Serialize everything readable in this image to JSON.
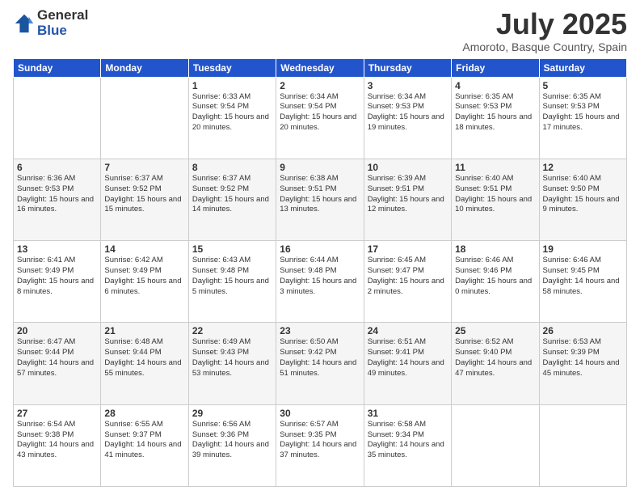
{
  "logo": {
    "general": "General",
    "blue": "Blue"
  },
  "title": {
    "month": "July 2025",
    "location": "Amoroto, Basque Country, Spain"
  },
  "headers": [
    "Sunday",
    "Monday",
    "Tuesday",
    "Wednesday",
    "Thursday",
    "Friday",
    "Saturday"
  ],
  "weeks": [
    [
      {
        "day": "",
        "sunrise": "",
        "sunset": "",
        "daylight": ""
      },
      {
        "day": "",
        "sunrise": "",
        "sunset": "",
        "daylight": ""
      },
      {
        "day": "1",
        "sunrise": "Sunrise: 6:33 AM",
        "sunset": "Sunset: 9:54 PM",
        "daylight": "Daylight: 15 hours and 20 minutes."
      },
      {
        "day": "2",
        "sunrise": "Sunrise: 6:34 AM",
        "sunset": "Sunset: 9:54 PM",
        "daylight": "Daylight: 15 hours and 20 minutes."
      },
      {
        "day": "3",
        "sunrise": "Sunrise: 6:34 AM",
        "sunset": "Sunset: 9:53 PM",
        "daylight": "Daylight: 15 hours and 19 minutes."
      },
      {
        "day": "4",
        "sunrise": "Sunrise: 6:35 AM",
        "sunset": "Sunset: 9:53 PM",
        "daylight": "Daylight: 15 hours and 18 minutes."
      },
      {
        "day": "5",
        "sunrise": "Sunrise: 6:35 AM",
        "sunset": "Sunset: 9:53 PM",
        "daylight": "Daylight: 15 hours and 17 minutes."
      }
    ],
    [
      {
        "day": "6",
        "sunrise": "Sunrise: 6:36 AM",
        "sunset": "Sunset: 9:53 PM",
        "daylight": "Daylight: 15 hours and 16 minutes."
      },
      {
        "day": "7",
        "sunrise": "Sunrise: 6:37 AM",
        "sunset": "Sunset: 9:52 PM",
        "daylight": "Daylight: 15 hours and 15 minutes."
      },
      {
        "day": "8",
        "sunrise": "Sunrise: 6:37 AM",
        "sunset": "Sunset: 9:52 PM",
        "daylight": "Daylight: 15 hours and 14 minutes."
      },
      {
        "day": "9",
        "sunrise": "Sunrise: 6:38 AM",
        "sunset": "Sunset: 9:51 PM",
        "daylight": "Daylight: 15 hours and 13 minutes."
      },
      {
        "day": "10",
        "sunrise": "Sunrise: 6:39 AM",
        "sunset": "Sunset: 9:51 PM",
        "daylight": "Daylight: 15 hours and 12 minutes."
      },
      {
        "day": "11",
        "sunrise": "Sunrise: 6:40 AM",
        "sunset": "Sunset: 9:51 PM",
        "daylight": "Daylight: 15 hours and 10 minutes."
      },
      {
        "day": "12",
        "sunrise": "Sunrise: 6:40 AM",
        "sunset": "Sunset: 9:50 PM",
        "daylight": "Daylight: 15 hours and 9 minutes."
      }
    ],
    [
      {
        "day": "13",
        "sunrise": "Sunrise: 6:41 AM",
        "sunset": "Sunset: 9:49 PM",
        "daylight": "Daylight: 15 hours and 8 minutes."
      },
      {
        "day": "14",
        "sunrise": "Sunrise: 6:42 AM",
        "sunset": "Sunset: 9:49 PM",
        "daylight": "Daylight: 15 hours and 6 minutes."
      },
      {
        "day": "15",
        "sunrise": "Sunrise: 6:43 AM",
        "sunset": "Sunset: 9:48 PM",
        "daylight": "Daylight: 15 hours and 5 minutes."
      },
      {
        "day": "16",
        "sunrise": "Sunrise: 6:44 AM",
        "sunset": "Sunset: 9:48 PM",
        "daylight": "Daylight: 15 hours and 3 minutes."
      },
      {
        "day": "17",
        "sunrise": "Sunrise: 6:45 AM",
        "sunset": "Sunset: 9:47 PM",
        "daylight": "Daylight: 15 hours and 2 minutes."
      },
      {
        "day": "18",
        "sunrise": "Sunrise: 6:46 AM",
        "sunset": "Sunset: 9:46 PM",
        "daylight": "Daylight: 15 hours and 0 minutes."
      },
      {
        "day": "19",
        "sunrise": "Sunrise: 6:46 AM",
        "sunset": "Sunset: 9:45 PM",
        "daylight": "Daylight: 14 hours and 58 minutes."
      }
    ],
    [
      {
        "day": "20",
        "sunrise": "Sunrise: 6:47 AM",
        "sunset": "Sunset: 9:44 PM",
        "daylight": "Daylight: 14 hours and 57 minutes."
      },
      {
        "day": "21",
        "sunrise": "Sunrise: 6:48 AM",
        "sunset": "Sunset: 9:44 PM",
        "daylight": "Daylight: 14 hours and 55 minutes."
      },
      {
        "day": "22",
        "sunrise": "Sunrise: 6:49 AM",
        "sunset": "Sunset: 9:43 PM",
        "daylight": "Daylight: 14 hours and 53 minutes."
      },
      {
        "day": "23",
        "sunrise": "Sunrise: 6:50 AM",
        "sunset": "Sunset: 9:42 PM",
        "daylight": "Daylight: 14 hours and 51 minutes."
      },
      {
        "day": "24",
        "sunrise": "Sunrise: 6:51 AM",
        "sunset": "Sunset: 9:41 PM",
        "daylight": "Daylight: 14 hours and 49 minutes."
      },
      {
        "day": "25",
        "sunrise": "Sunrise: 6:52 AM",
        "sunset": "Sunset: 9:40 PM",
        "daylight": "Daylight: 14 hours and 47 minutes."
      },
      {
        "day": "26",
        "sunrise": "Sunrise: 6:53 AM",
        "sunset": "Sunset: 9:39 PM",
        "daylight": "Daylight: 14 hours and 45 minutes."
      }
    ],
    [
      {
        "day": "27",
        "sunrise": "Sunrise: 6:54 AM",
        "sunset": "Sunset: 9:38 PM",
        "daylight": "Daylight: 14 hours and 43 minutes."
      },
      {
        "day": "28",
        "sunrise": "Sunrise: 6:55 AM",
        "sunset": "Sunset: 9:37 PM",
        "daylight": "Daylight: 14 hours and 41 minutes."
      },
      {
        "day": "29",
        "sunrise": "Sunrise: 6:56 AM",
        "sunset": "Sunset: 9:36 PM",
        "daylight": "Daylight: 14 hours and 39 minutes."
      },
      {
        "day": "30",
        "sunrise": "Sunrise: 6:57 AM",
        "sunset": "Sunset: 9:35 PM",
        "daylight": "Daylight: 14 hours and 37 minutes."
      },
      {
        "day": "31",
        "sunrise": "Sunrise: 6:58 AM",
        "sunset": "Sunset: 9:34 PM",
        "daylight": "Daylight: 14 hours and 35 minutes."
      },
      {
        "day": "",
        "sunrise": "",
        "sunset": "",
        "daylight": ""
      },
      {
        "day": "",
        "sunrise": "",
        "sunset": "",
        "daylight": ""
      }
    ]
  ]
}
